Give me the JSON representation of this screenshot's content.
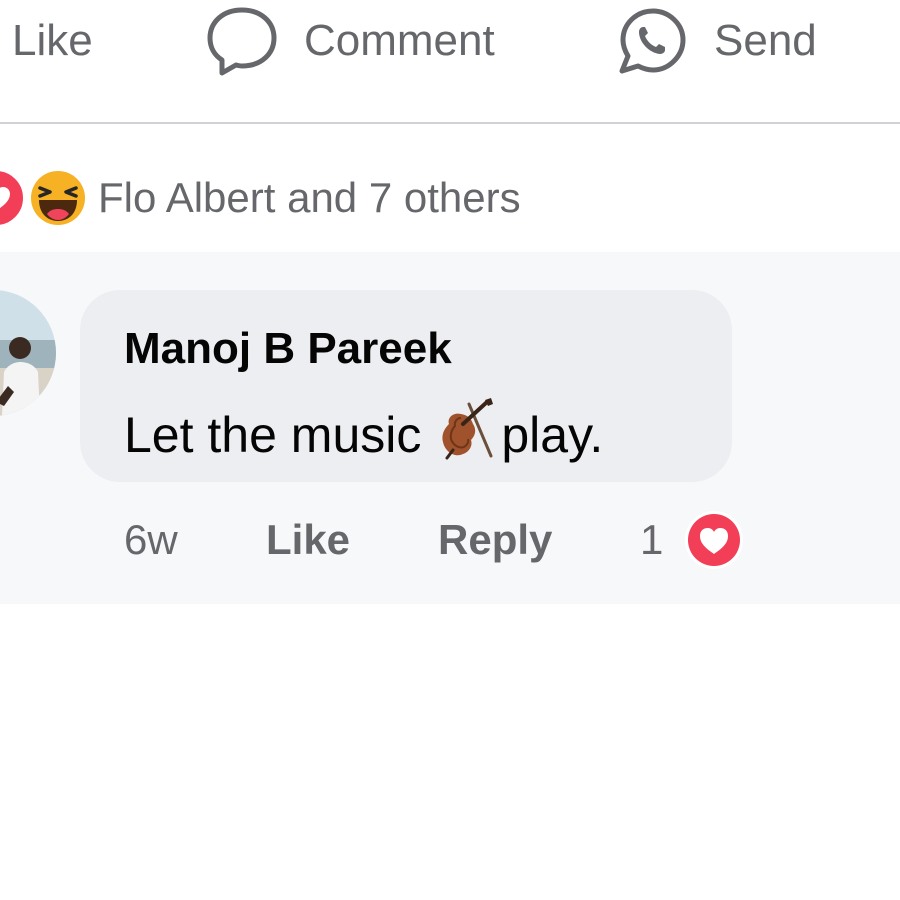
{
  "actions": {
    "like_label": "Like",
    "comment_label": "Comment",
    "send_label": "Send"
  },
  "reactions": {
    "summary": "Flo Albert and 7 others",
    "icons": [
      "love-reaction-icon",
      "haha-reaction-icon"
    ]
  },
  "comment": {
    "author": "Manoj B Pareek",
    "text_before": "Let the music",
    "emoji": "violin-emoji",
    "text_after": "play.",
    "time": "6w",
    "like_label": "Like",
    "reply_label": "Reply",
    "reaction_count": "1",
    "reaction_icon": "love-reaction-icon"
  },
  "colors": {
    "secondary_text": "#65676b",
    "primary_text": "#050505",
    "bubble": "#eceef1",
    "love": "#f33e58",
    "haha": "#f7b125"
  }
}
